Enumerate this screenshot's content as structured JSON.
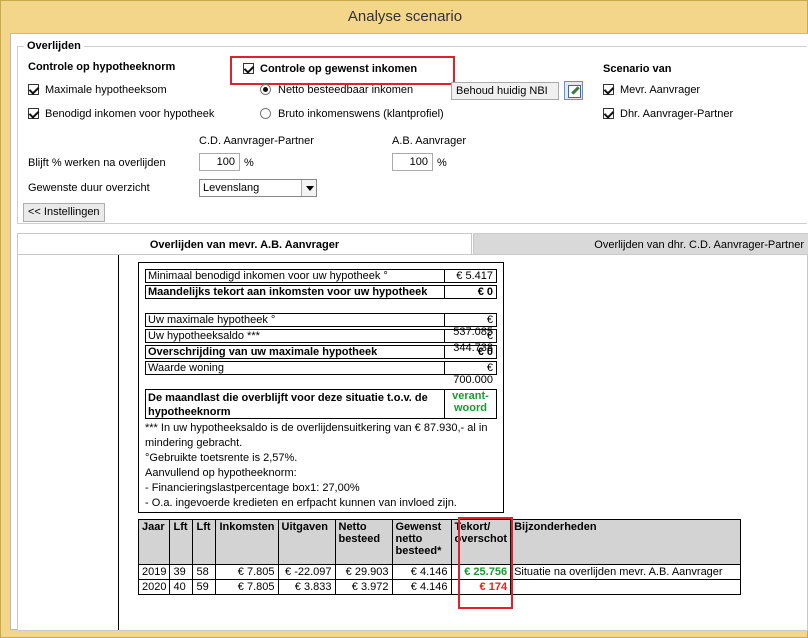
{
  "window": {
    "title": "Analyse scenario"
  },
  "group": {
    "title": "Overlijden"
  },
  "hypotheeknorm": {
    "heading": "Controle op hypotheeknorm",
    "checkbox1": "Maximale hypotheeksom",
    "checkbox2": "Benodigd inkomen voor hypotheek"
  },
  "inkomen": {
    "heading": "Controle op gewenst inkomen",
    "radio1": "Netto besteedbaar inkomen",
    "radio2": "Bruto inkomenswens (klantprofiel)",
    "nbi_value": "Behoud huidig NBI"
  },
  "scenario": {
    "heading": "Scenario van",
    "option1": "Mevr. Aanvrager",
    "option2": "Dhr. Aanvrager-Partner"
  },
  "params": {
    "col1_header": "C.D. Aanvrager-Partner",
    "col2_header": "A.B. Aanvrager",
    "werken_label": "Blijft % werken na overlijden",
    "werken1": "100",
    "werken2": "100",
    "percent": "%",
    "duur_label": "Gewenste duur overzicht",
    "duur_value": "Levenslang",
    "settings_button": "<< Instellingen"
  },
  "tabs": {
    "tab1": "Overlijden van mevr. A.B. Aanvrager",
    "tab2": "Overlijden van dhr. C.D. Aanvrager-Partner"
  },
  "summary": {
    "r1_label": "Minimaal benodigd inkomen voor uw hypotheek °",
    "r1_value": "€ 5.417",
    "r2_label": "Maandelijks tekort aan inkomsten voor uw hypotheek",
    "r2_value": "€ 0",
    "r3_label": "Uw maximale hypotheek °",
    "r3_value": "€ 537.085",
    "r4_label": "Uw hypotheeksaldo ***",
    "r4_value": "€ 344.738",
    "r5_label": "Overschrijding van uw maximale hypotheek",
    "r5_value": "€ 0",
    "r6_label": "Waarde woning",
    "r6_value": "€ 700.000",
    "maandlast_line1": "De maandlast die overblijft voor deze situatie t.o.v. de",
    "maandlast_line2": "hypotheeknorm",
    "verant1": "verant-",
    "verant2": "woord",
    "note1": "*** In uw hypotheeksaldo is de overlijdensuitkering van € 87.930,- al in",
    "note2": "mindering gebracht.",
    "note3": "°Gebruikte toetsrente is 2,57%.",
    "note4": "Aanvullend op hypotheeknorm:",
    "note5": "- Financieringslastpercentage box1: 27,00%",
    "note6": "- O.a. ingevoerde kredieten en erfpacht kunnen van invloed zijn."
  },
  "table": {
    "headers": [
      "Jaar",
      "Lft",
      "Lft",
      "Inkomsten",
      "Uitgaven",
      "Netto besteed",
      "Gewenst netto besteed*",
      "Tekort/ overschot",
      "Bijzonderheden"
    ],
    "rows": [
      [
        "2019",
        "39",
        "58",
        "€ 7.805",
        "€ -22.097",
        "€ 29.903",
        "€ 4.146",
        "€ 25.756",
        "Situatie na overlijden mevr. A.B. Aanvrager"
      ],
      [
        "2020",
        "40",
        "59",
        "€ 7.805",
        "€ 3.833",
        "€ 3.972",
        "€ 4.146",
        "€ 174",
        ""
      ]
    ]
  }
}
